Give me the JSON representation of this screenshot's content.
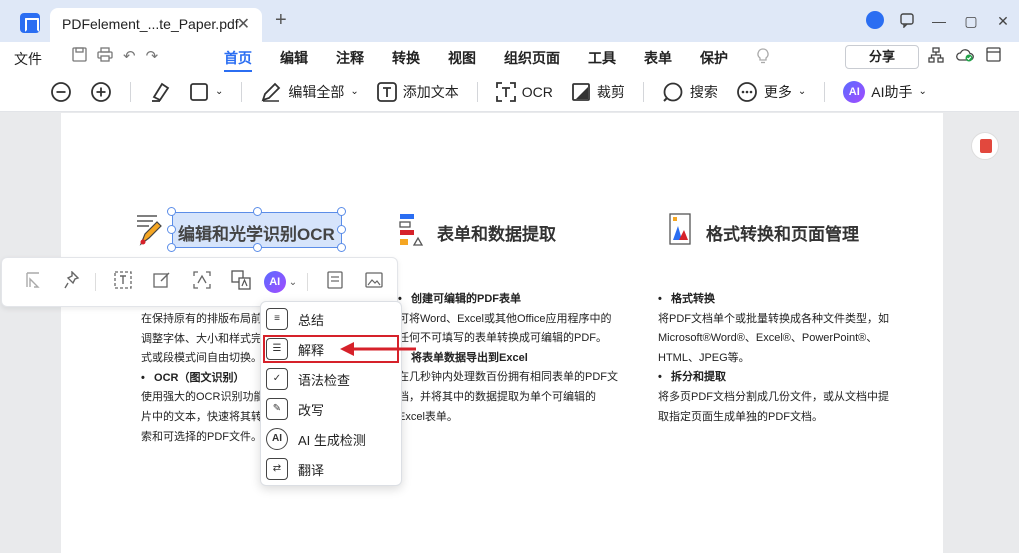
{
  "titlebar": {
    "tab_title": "PDFelement_...te_Paper.pdf",
    "tab_close": "✕",
    "new_tab": "+",
    "min_icon": "—",
    "max_icon": "▢",
    "close_icon": "✕"
  },
  "menubar": {
    "file": "文件",
    "tabs": [
      "首页",
      "编辑",
      "注释",
      "转换",
      "视图",
      "组织页面",
      "工具",
      "表单",
      "保护"
    ],
    "active_tab": "首页",
    "share": "分享"
  },
  "toolbar": {
    "edit_all": "编辑全部",
    "add_text": "添加文本",
    "ocr": "OCR",
    "crop": "裁剪",
    "search": "搜索",
    "more": "更多",
    "ai_badge": "AI",
    "ai_assistant": "AI助手"
  },
  "page": {
    "sections": [
      {
        "title": "编辑和光学识别OCR"
      },
      {
        "title": "表单和数据提取"
      },
      {
        "title": "格式转换和页面管理"
      }
    ],
    "col1": {
      "line1": "在保持原有的排版布局前",
      "line2": "调整字体、大小和样式完",
      "line3": "式或段模式间自由切换。",
      "bullet2": "OCR（图文识别）",
      "line4": "使用强大的OCR识别功能",
      "line5": "片中的文本，快速将其转",
      "line6": "索和可选择的PDF文件。"
    },
    "col2": {
      "bullet1": "创建可编辑的PDF表单",
      "line1": "可将Word、Excel或其他Office应用程序中的",
      "line2": "任何不可填写的表单转换成可编辑的PDF。",
      "bullet2": "将表单数据导出到Excel",
      "line3": "在几秒钟内处理数百份拥有相同表单的PDF文",
      "line4": "档，并将其中的数据提取为单个可编辑的",
      "line5": "Excel表单。"
    },
    "col3": {
      "bullet1": "格式转换",
      "line1": "将PDF文档单个或批量转换成各种文件类型，如",
      "line2": "Microsoft®Word®、Excel®、PowerPoint®、",
      "line3": "HTML、JPEG等。",
      "bullet2": "拆分和提取",
      "line4": "将多页PDF文档分割成几份文件，或从文档中提",
      "line5": "取指定页面生成单独的PDF文档。"
    }
  },
  "float_toolbar": {
    "ai_label": "AI"
  },
  "ai_menu": {
    "items": [
      "总结",
      "解释",
      "语法检查",
      "改写",
      "AI 生成检测",
      "翻译"
    ],
    "highlighted": "解释",
    "detect_icon": "AI"
  },
  "colors": {
    "accent": "#2b6ef2",
    "highlight": "#d6212a"
  }
}
